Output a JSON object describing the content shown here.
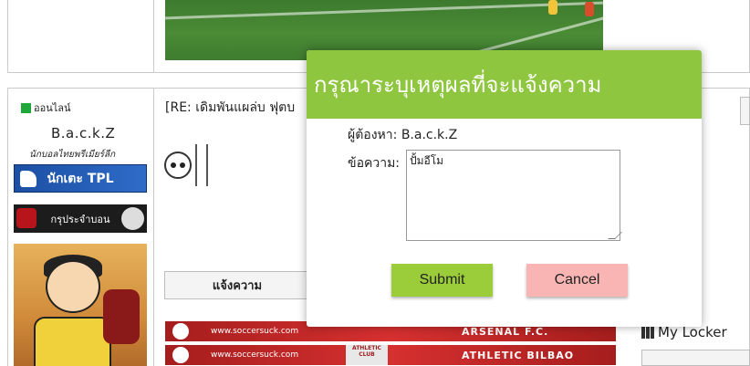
{
  "top_post": {},
  "profile": {
    "status_label": "ออนไลน์",
    "username": "B.a.c.k.Z",
    "user_title": "นักบอลไทยพรีเมียร์ลีก",
    "badge_tpl_label": "นักเตะ TPL",
    "badge_group_label": "กรุประจำบอน"
  },
  "post": {
    "title": "[RE: เดิมพันแผล่บ ฟุตบ",
    "report_button_label": "แจ้งความ",
    "signatures": [
      {
        "url": "www.soccersuck.com",
        "team": "ARSENAL F.C."
      },
      {
        "url": "www.soccersuck.com",
        "team": "ATHLETIC BILBAO",
        "crest_text": "ATHLETIC CLUB"
      }
    ]
  },
  "sidebar": {
    "locker_label": "My Locker"
  },
  "dialog": {
    "title": "กรุณาระบุเหตุผลที่จะแจ้งความ",
    "to_label": "ผู้ต้องหา:",
    "to_value": "B.a.c.k.Z",
    "message_label": "ข้อความ:",
    "message_value": "ปั้มอีโม",
    "submit_label": "Submit",
    "cancel_label": "Cancel",
    "colors": {
      "header": "#8ec63f",
      "submit": "#9bcc3a",
      "cancel": "#f9b4b4"
    }
  }
}
